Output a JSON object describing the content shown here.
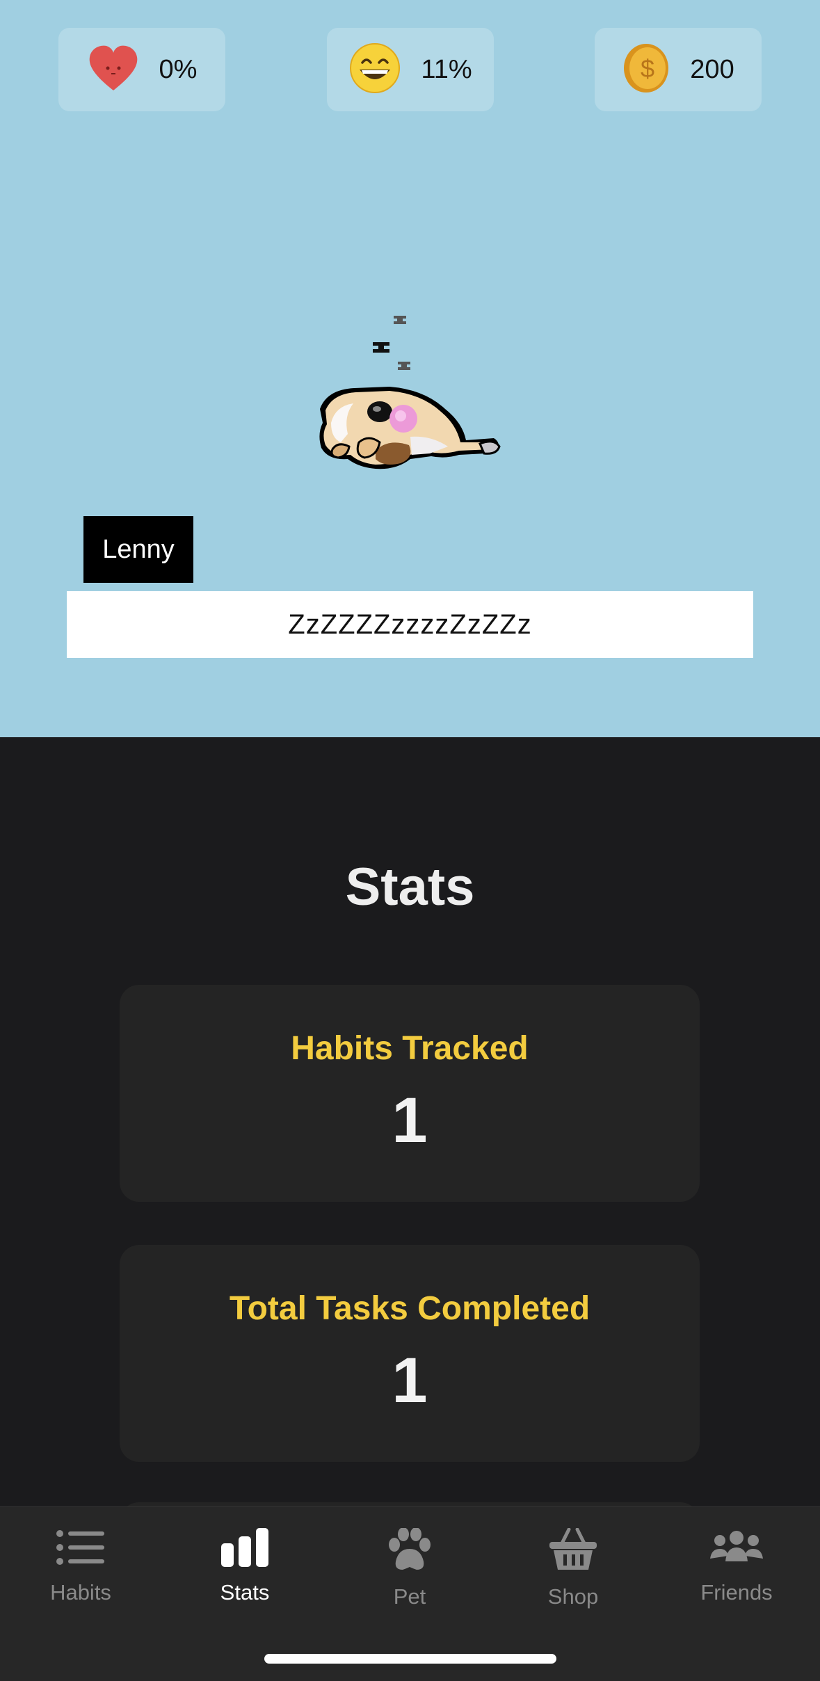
{
  "status": {
    "health": {
      "value": "0%",
      "icon": "heart-icon",
      "color": "#e0524f"
    },
    "happiness": {
      "value": "11%",
      "icon": "smile-face-icon",
      "color": "#f7d23a"
    },
    "coins": {
      "value": "200",
      "icon": "coin-icon",
      "color": "#e2a62b"
    }
  },
  "pet": {
    "name": "Lenny",
    "speech": "ZzZZZZzzzzZzZZz",
    "state_icon": "sleeping-pet"
  },
  "stats": {
    "title": "Stats",
    "cards": [
      {
        "label": "Habits Tracked",
        "value": "1"
      },
      {
        "label": "Total Tasks Completed",
        "value": "1"
      }
    ]
  },
  "tabs": [
    {
      "label": "Habits",
      "icon": "list-icon",
      "active": false
    },
    {
      "label": "Stats",
      "icon": "bar-chart-icon",
      "active": true
    },
    {
      "label": "Pet",
      "icon": "paw-icon",
      "active": false
    },
    {
      "label": "Shop",
      "icon": "basket-icon",
      "active": false
    },
    {
      "label": "Friends",
      "icon": "people-icon",
      "active": false
    }
  ],
  "colors": {
    "sky": "#a0cfe1",
    "background": "#1b1b1d",
    "card": "#242424",
    "accent": "#f3cc3f"
  }
}
